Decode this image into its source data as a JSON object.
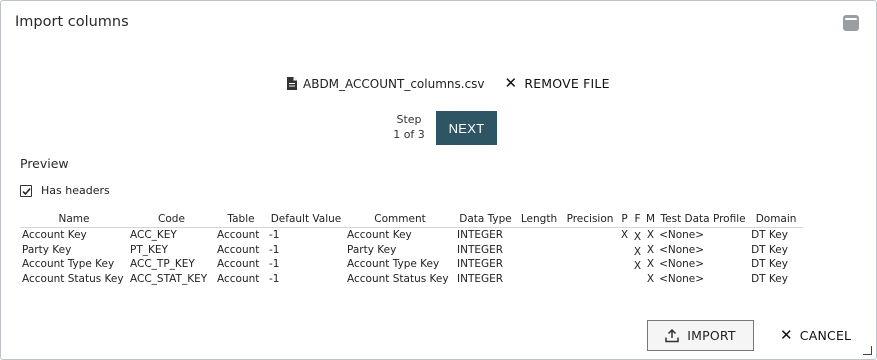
{
  "dialog": {
    "title": "Import columns"
  },
  "file": {
    "name": "ABDM_ACCOUNT_columns.csv",
    "remove_label": "REMOVE FILE"
  },
  "step": {
    "label": "Step",
    "progress": "1 of 3",
    "next_label": "NEXT"
  },
  "preview": {
    "heading": "Preview",
    "has_headers_label": "Has headers",
    "has_headers_checked": true,
    "columns": [
      "Name",
      "Code",
      "Table",
      "Default Value",
      "Comment",
      "Data Type",
      "Length",
      "Precision",
      "P",
      "F",
      "M",
      "Test Data Profile",
      "Domain"
    ],
    "rows": [
      [
        "Account Key",
        "ACC_KEY",
        "Account",
        "-1",
        "Account Key",
        "INTEGER",
        "",
        "",
        "X",
        "X",
        "X",
        "<None>",
        "DT Key"
      ],
      [
        "Party Key",
        "PT_KEY",
        "Account",
        "-1",
        "Party Key",
        "INTEGER",
        "",
        "",
        "",
        "X",
        "X",
        "<None>",
        "DT Key"
      ],
      [
        "Account Type Key",
        "ACC_TP_KEY",
        "Account",
        "-1",
        "Account Type Key",
        "INTEGER",
        "",
        "",
        "",
        "X",
        "X",
        "<None>",
        "DT Key"
      ],
      [
        "Account Status Key",
        "ACC_STAT_KEY",
        "Account",
        "-1",
        "Account Status Key",
        "INTEGER",
        "",
        "",
        "",
        "",
        "X",
        "<None>",
        "DT Key"
      ]
    ]
  },
  "actions": {
    "import_label": "IMPORT",
    "cancel_label": "CANCEL"
  },
  "colors": {
    "primary": "#2d5563",
    "border": "#bfc4c8"
  },
  "icons": {
    "minimize": "minimize-icon",
    "file": "file-icon",
    "remove": "close-icon",
    "checkbox": "checkmark-icon",
    "upload": "upload-icon",
    "cancel": "close-icon",
    "resize": "resize-handle-icon"
  }
}
